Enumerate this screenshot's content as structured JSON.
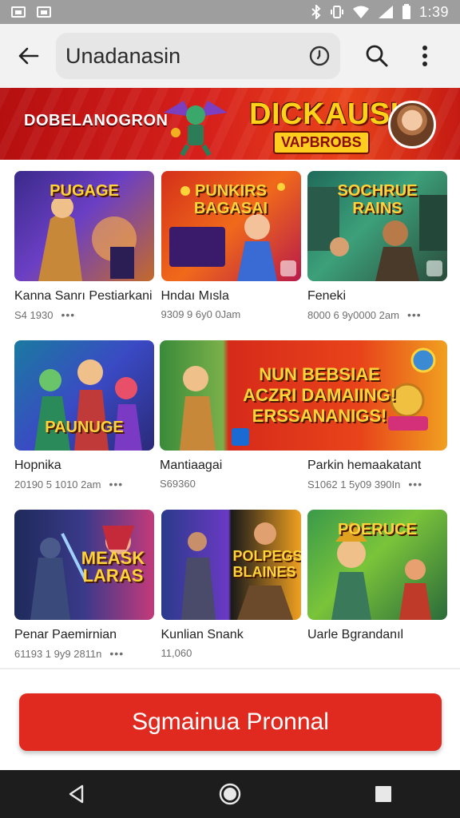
{
  "status_bar": {
    "time": "1:39",
    "icons": [
      "gallery-icon",
      "photo-icon",
      "bluetooth-icon",
      "vibrate-icon",
      "wifi-icon",
      "signal-icon",
      "battery-icon"
    ]
  },
  "app_bar": {
    "back_icon": "arrow-left-icon",
    "search_query": "Unadanasin",
    "history_icon": "clock-icon",
    "search_icon": "search-icon",
    "menu_icon": "more-vertical-icon"
  },
  "banner": {
    "left_text": "DOBELANOGRON",
    "title": "DICKAUSK",
    "subtitle": "VAPBROBS"
  },
  "games": [
    {
      "title": "Kanna Sanrı Pestiarkani",
      "meta": "S4 1930",
      "art_text": "PUGAGE"
    },
    {
      "title": "Hndaı Mısla",
      "meta": "9309 9 6y0 0Jam",
      "art_text": "PUNKIRS BAGASAI"
    },
    {
      "title": "Feneki",
      "meta": "8000 6 9y0000 2am",
      "art_text": "SOCHRUE RAINS"
    },
    {
      "title": "Hopnika",
      "meta": "20190 5 1010 2am",
      "art_text": "PAUNUGE"
    },
    {
      "title": "Mantiaagai",
      "meta": "S69360",
      "art_text": "NUN BEBSIAE ACZRI DAMAIING! ERSSANANIGS!"
    },
    {
      "title": "Parkin hemaakatant",
      "meta": "S1062 1 5y09 390In",
      "art_text": ""
    },
    {
      "title": "Penar Paemirnian",
      "meta": "61193 1 9y9 2811n",
      "art_text": "MEASK LARAS"
    },
    {
      "title": "Kunlian Snank",
      "meta": "11,060",
      "art_text": "POLPEGS BLAINES"
    },
    {
      "title": "Uarle Bgrandanıl",
      "meta": "",
      "art_text": "POERUCE"
    }
  ],
  "primary_button": {
    "label": "Sgmainua Pronnal"
  },
  "nav_bar": {
    "back": "triangle-back-icon",
    "home": "circle-home-icon",
    "recents": "square-recents-icon"
  },
  "colors": {
    "accent": "#e02a20",
    "status_bar": "#9e9e9e",
    "app_bar": "#f2f2f2",
    "nav_bar": "#1d1d1d"
  }
}
